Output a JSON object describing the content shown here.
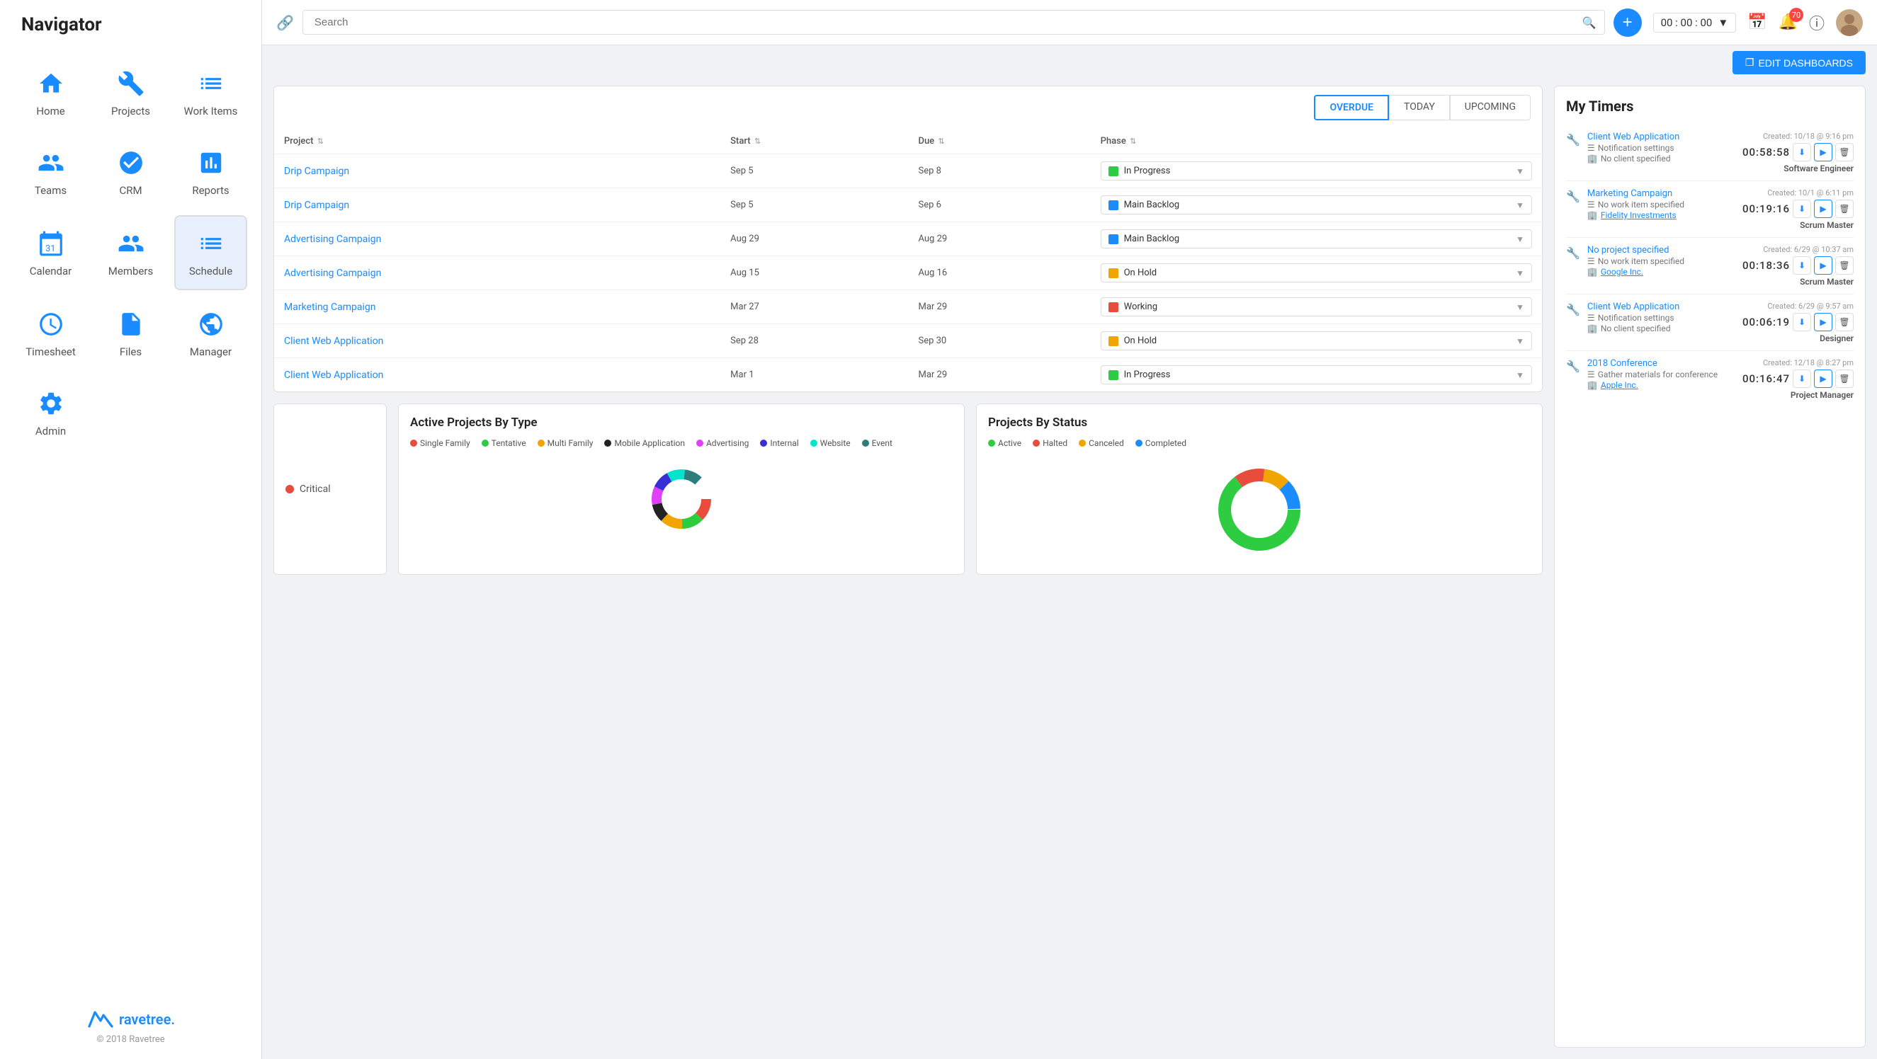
{
  "app": {
    "title": "Navigator",
    "copyright": "© 2018 Ravetree"
  },
  "header": {
    "search_placeholder": "Search",
    "timer": "00 : 00 : 00",
    "notification_count": "70",
    "edit_dashboards_label": "EDIT DASHBOARDS"
  },
  "sidebar": {
    "items": [
      {
        "id": "home",
        "label": "Home",
        "icon": "home"
      },
      {
        "id": "projects",
        "label": "Projects",
        "icon": "projects"
      },
      {
        "id": "work-items",
        "label": "Work Items",
        "icon": "work-items",
        "active": true
      },
      {
        "id": "teams",
        "label": "Teams",
        "icon": "teams"
      },
      {
        "id": "crm",
        "label": "CRM",
        "icon": "crm"
      },
      {
        "id": "reports",
        "label": "Reports",
        "icon": "reports"
      },
      {
        "id": "calendar",
        "label": "Calendar",
        "icon": "calendar"
      },
      {
        "id": "members",
        "label": "Members",
        "icon": "members"
      },
      {
        "id": "schedule",
        "label": "Schedule",
        "icon": "schedule",
        "active": true
      },
      {
        "id": "timesheet",
        "label": "Timesheet",
        "icon": "timesheet"
      },
      {
        "id": "files",
        "label": "Files",
        "icon": "files"
      },
      {
        "id": "manager",
        "label": "Manager",
        "icon": "manager"
      },
      {
        "id": "admin",
        "label": "Admin",
        "icon": "admin"
      }
    ]
  },
  "work_items": {
    "tabs": [
      "OVERDUE",
      "TODAY",
      "UPCOMING"
    ],
    "active_tab": "OVERDUE",
    "columns": [
      "Project",
      "Start",
      "Due",
      "Phase"
    ],
    "rows": [
      {
        "project": "Drip Campaign",
        "start": "Sep 5",
        "due": "Sep 8",
        "phase": "In Progress",
        "phase_color": "#2ecc40"
      },
      {
        "project": "Drip Campaign",
        "start": "Sep 5",
        "due": "Sep 6",
        "phase": "Main Backlog",
        "phase_color": "#1a8cff"
      },
      {
        "project": "Advertising Campaign",
        "start": "Aug 29",
        "due": "Aug 29",
        "phase": "Main Backlog",
        "phase_color": "#1a8cff"
      },
      {
        "project": "Advertising Campaign",
        "start": "Aug 15",
        "due": "Aug 16",
        "phase": "On Hold",
        "phase_color": "#f0a500"
      },
      {
        "project": "Marketing Campaign",
        "start": "Mar 27",
        "due": "Mar 29",
        "phase": "Working",
        "phase_color": "#e74c3c"
      },
      {
        "project": "Client Web Application",
        "start": "Sep 28",
        "due": "Sep 30",
        "phase": "On Hold",
        "phase_color": "#f0a500"
      },
      {
        "project": "Client Web Application",
        "start": "Mar 1",
        "due": "Mar 29",
        "phase": "In Progress",
        "phase_color": "#2ecc40"
      }
    ]
  },
  "my_timers": {
    "title": "My Timers",
    "entries": [
      {
        "project": "Client Web Application",
        "work_item": "Notification settings",
        "client": "No client specified",
        "created": "Created: 10/18 @ 9:16 pm",
        "time": "00:58:58",
        "role": "Software Engineer"
      },
      {
        "project": "Marketing Campaign",
        "work_item": "No work item specified",
        "client": "Fidelity Investments",
        "created": "Created: 10/1 @ 6:11 pm",
        "time": "00:19:16",
        "role": "Scrum Master"
      },
      {
        "project": "No project specified",
        "work_item": "No work item specified",
        "client": "Google Inc.",
        "created": "Created: 6/29 @ 10:37 am",
        "time": "00:18:36",
        "role": "Scrum Master"
      },
      {
        "project": "Client Web Application",
        "work_item": "Notification settings",
        "client": "No client specified",
        "created": "Created: 6/29 @ 9:57 am",
        "time": "00:06:19",
        "role": "Designer"
      },
      {
        "project": "2018 Conference",
        "work_item": "Gather materials for conference",
        "client": "Apple Inc.",
        "created": "Created: 12/18 @ 8:27 pm",
        "time": "00:16:47",
        "role": "Project Manager"
      }
    ]
  },
  "active_projects": {
    "title": "Active Projects By Type",
    "legend": [
      {
        "label": "Single Family",
        "color": "#e74c3c"
      },
      {
        "label": "Tentative",
        "color": "#2ecc40"
      },
      {
        "label": "Multi Family",
        "color": "#f0a500"
      },
      {
        "label": "Mobile Application",
        "color": "#222"
      },
      {
        "label": "Advertising",
        "color": "#e040fb"
      },
      {
        "label": "Internal",
        "color": "#3730d4"
      },
      {
        "label": "Website",
        "color": "#00e5cc"
      },
      {
        "label": "Event",
        "color": "#2e7d7d"
      }
    ]
  },
  "projects_by_status": {
    "title": "Projects By Status",
    "legend": [
      {
        "label": "Active",
        "color": "#2ecc40"
      },
      {
        "label": "Halted",
        "color": "#e74c3c"
      },
      {
        "label": "Canceled",
        "color": "#f0a500"
      },
      {
        "label": "Completed",
        "color": "#1a8cff"
      }
    ],
    "segments": [
      {
        "color": "#2ecc40",
        "pct": 65
      },
      {
        "color": "#e74c3c",
        "pct": 12
      },
      {
        "color": "#f0a500",
        "pct": 10
      },
      {
        "color": "#1a8cff",
        "pct": 13
      }
    ]
  },
  "critical": {
    "label": "Critical",
    "color": "#e74c3c"
  }
}
